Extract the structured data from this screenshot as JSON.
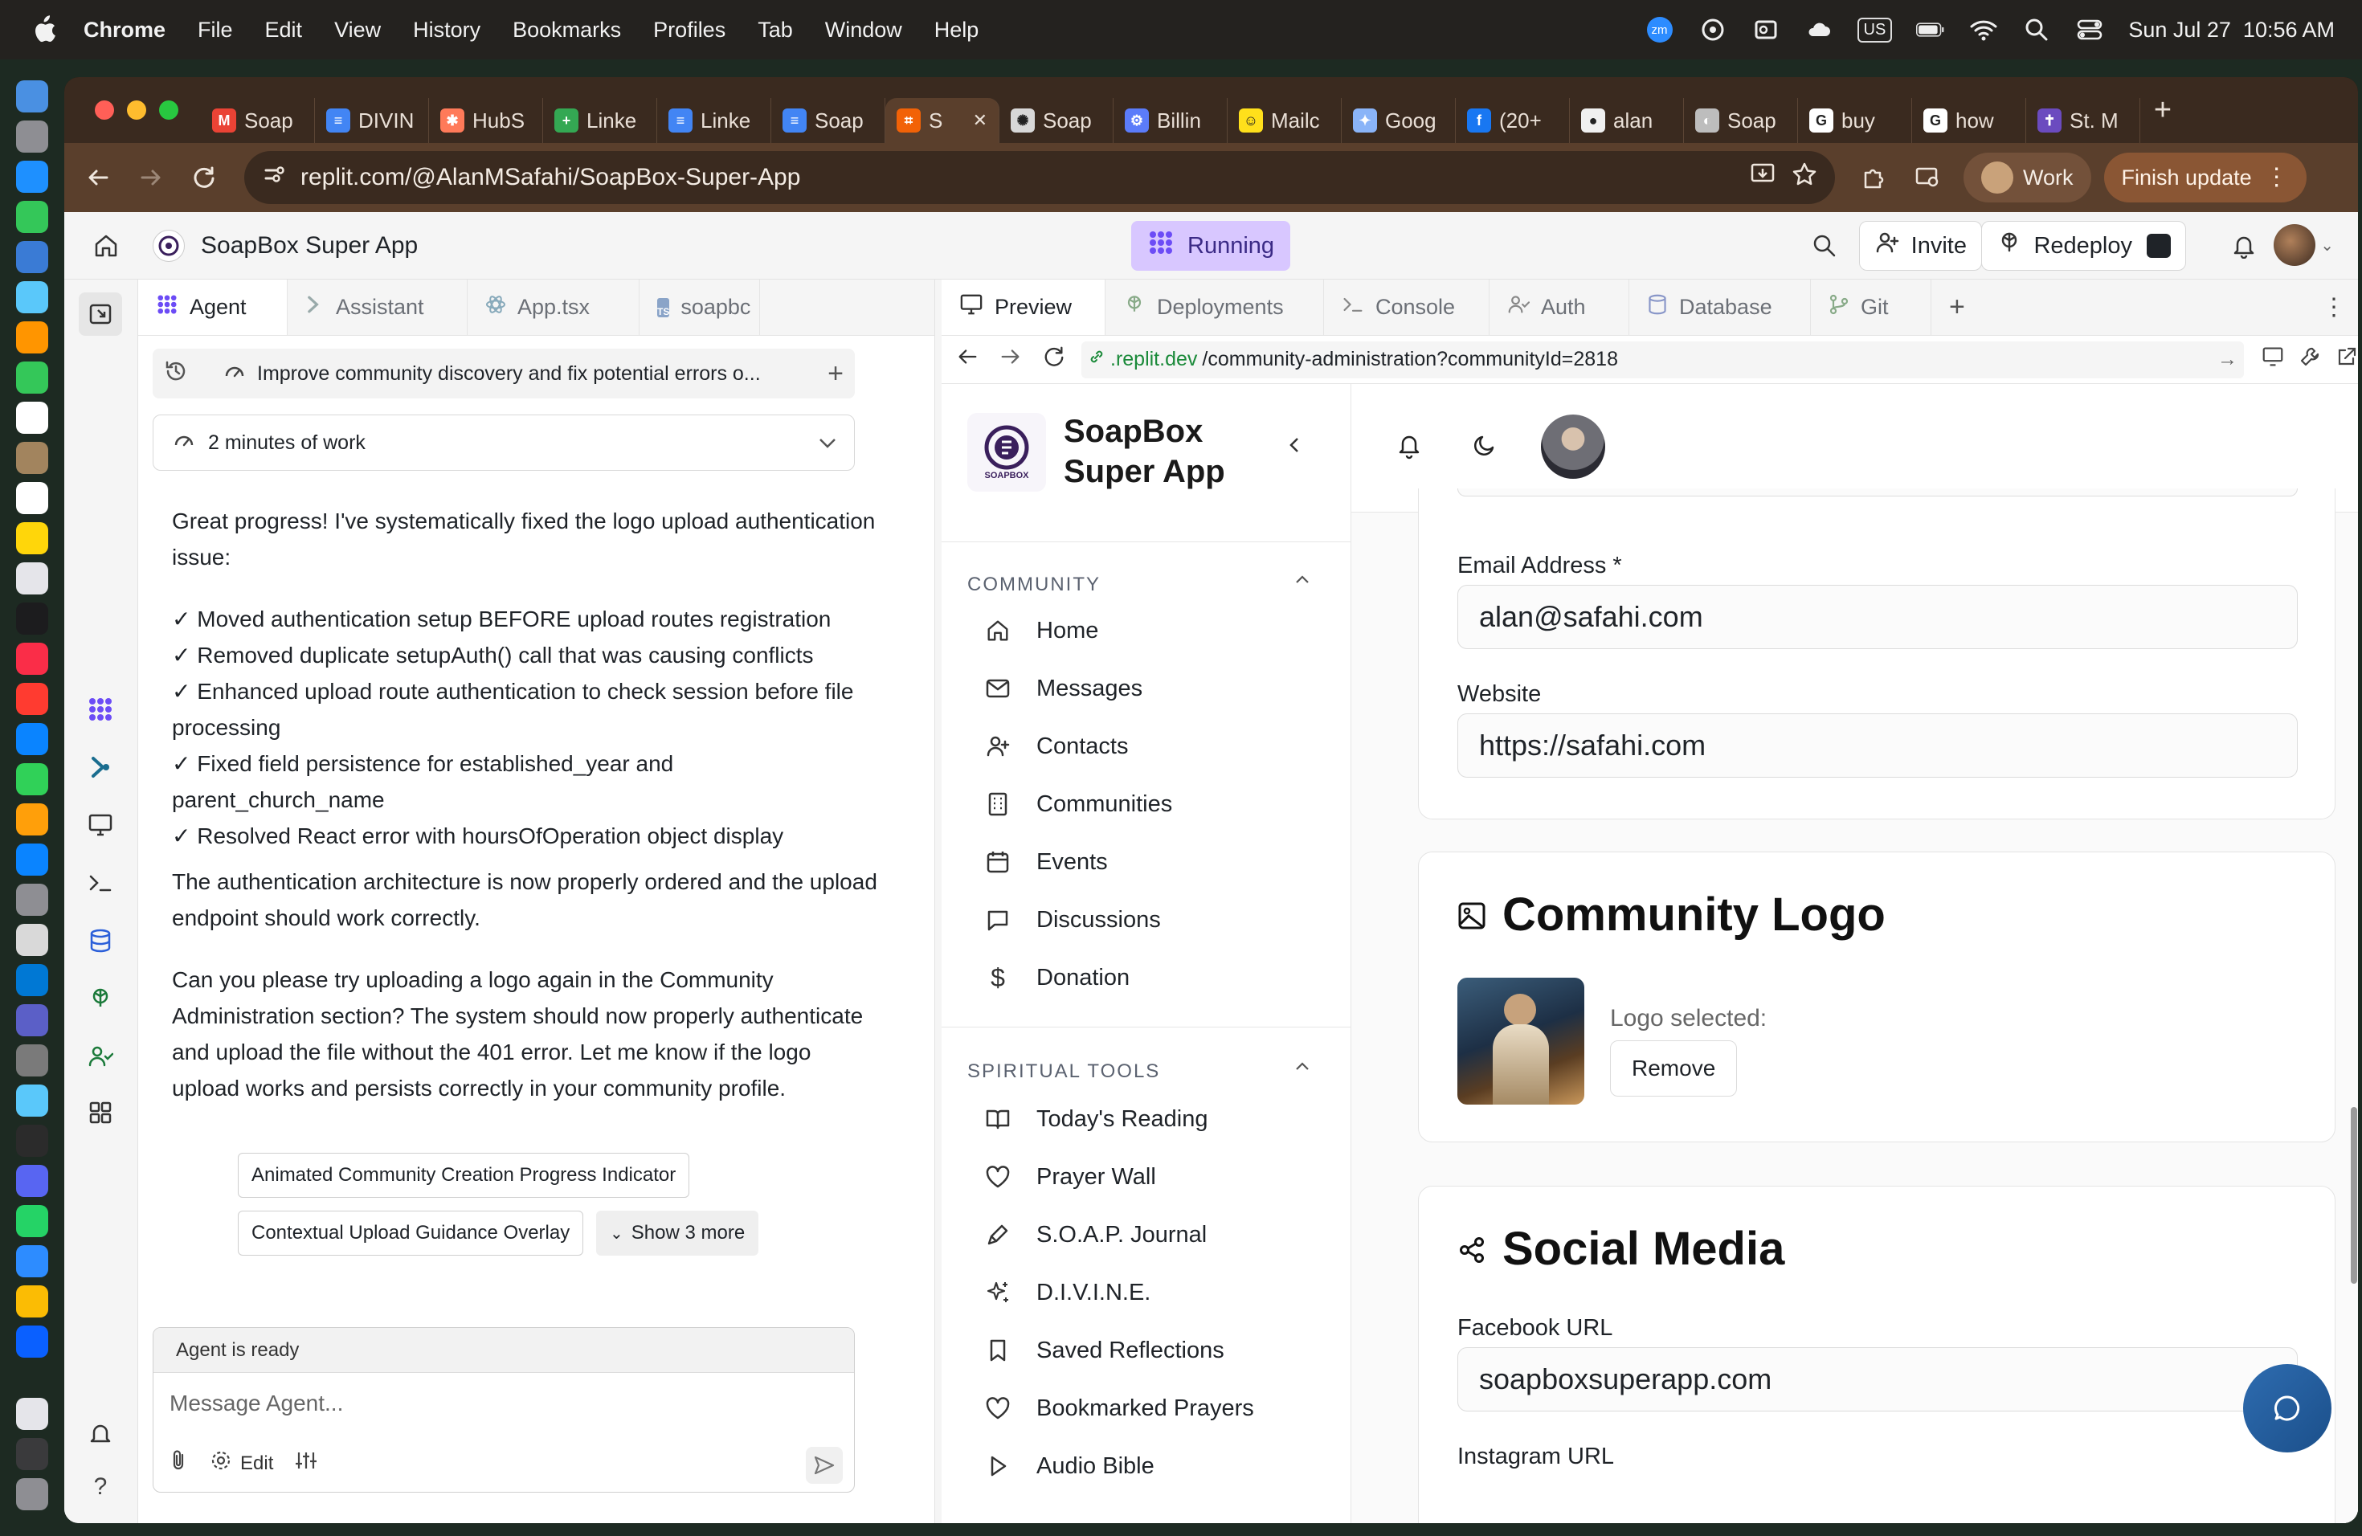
{
  "menubar": {
    "app": "Chrome",
    "items": [
      "File",
      "Edit",
      "View",
      "History",
      "Bookmarks",
      "Profiles",
      "Tab",
      "Window",
      "Help"
    ],
    "input_source": "US",
    "clock": "Sun Jul 27  10:56 AM",
    "zoom_badge": "zm"
  },
  "browser": {
    "tabs": [
      {
        "label": "Soap",
        "icon": "gmail-icon",
        "color": "#ea4335",
        "glyph": "M"
      },
      {
        "label": "DIVIN",
        "icon": "docs-icon",
        "color": "#4285f4",
        "glyph": "≡"
      },
      {
        "label": "HubS",
        "icon": "hubspot-icon",
        "color": "#ff7a59",
        "glyph": "✱"
      },
      {
        "label": "Linke",
        "icon": "sheets-icon",
        "color": "#34a853",
        "glyph": "+"
      },
      {
        "label": "Linke",
        "icon": "docs-icon",
        "color": "#4285f4",
        "glyph": "≡"
      },
      {
        "label": "Soap",
        "icon": "docs-icon",
        "color": "#4285f4",
        "glyph": "≡"
      },
      {
        "label": "S",
        "icon": "replit-icon",
        "color": "#f26207",
        "glyph": "⌗",
        "active": true
      },
      {
        "label": "Soap",
        "icon": "openai-icon",
        "color": "#d8d8d8",
        "glyph": "✺"
      },
      {
        "label": "Billin",
        "icon": "billing-icon",
        "color": "#5b7cfa",
        "glyph": "⚙"
      },
      {
        "label": "Mailc",
        "icon": "mailchimp-icon",
        "color": "#ffe01b",
        "glyph": "☺"
      },
      {
        "label": "Goog",
        "icon": "gemini-icon",
        "color": "#8ab4f8",
        "glyph": "✦"
      },
      {
        "label": "(20+",
        "icon": "facebook-icon",
        "color": "#1877f2",
        "glyph": "f"
      },
      {
        "label": "alan",
        "icon": "github-icon",
        "color": "#f0f0f0",
        "glyph": "●"
      },
      {
        "label": "Soap",
        "icon": "globe-icon",
        "color": "#bdbdbd",
        "glyph": "◐"
      },
      {
        "label": "buy",
        "icon": "google-icon",
        "color": "#ffffff",
        "glyph": "G"
      },
      {
        "label": "how",
        "icon": "google-icon",
        "color": "#ffffff",
        "glyph": "G"
      },
      {
        "label": "St. M",
        "icon": "church-icon",
        "color": "#6b4bbf",
        "glyph": "✝"
      }
    ],
    "url": "replit.com/@AlanMSafahi/SoapBox-Super-App",
    "profile": "Work",
    "update": "Finish update"
  },
  "replit": {
    "project": "SoapBox Super App",
    "status": "Running",
    "invite": "Invite",
    "redeploy": "Redeploy",
    "colors": {
      "running_bg": "#d8c7ff",
      "accent": "#6c4cf6"
    }
  },
  "agent": {
    "tabs": [
      "Agent",
      "Assistant",
      "App.tsx",
      "soapbc"
    ],
    "thread_title": "Improve community discovery and fix potential errors o...",
    "work_summary": "2 minutes of work",
    "message_intro": "Great progress! I've systematically fixed the logo upload authentication issue:",
    "bullets": [
      "✓ Moved authentication setup BEFORE upload routes registration",
      "✓ Removed duplicate setupAuth() call that was causing conflicts",
      "✓ Enhanced upload route authentication to check session before file processing",
      "✓ Fixed field persistence for established_year and parent_church_name",
      "✓ Resolved React error with hoursOfOperation object display"
    ],
    "message_p2": "The authentication architecture is now properly ordered and the upload endpoint should work correctly.",
    "message_p3": "Can you please try uploading a logo again in the Community Administration section? The system should now properly authenticate and upload the file without the 401 error. Let me know if the logo upload works and persists correctly in your community profile.",
    "suggestions": [
      "Animated Community Creation Progress Indicator",
      "Contextual Upload Guidance Overlay"
    ],
    "show_more": "Show 3 more",
    "status": "Agent is ready",
    "placeholder": "Message Agent...",
    "edit_label": "Edit"
  },
  "preview": {
    "tabs": [
      "Preview",
      "Deployments",
      "Console",
      "Auth",
      "Database",
      "Git"
    ],
    "url_host": ".replit.dev",
    "url_path": "/community-administration?communityId=2818"
  },
  "app": {
    "brand_line1": "SoapBox",
    "brand_line2": "Super App",
    "logo_text": "SOAPBOX",
    "sections": [
      {
        "label": "COMMUNITY",
        "items": [
          {
            "label": "Home",
            "icon": "home-icon"
          },
          {
            "label": "Messages",
            "icon": "mail-icon"
          },
          {
            "label": "Contacts",
            "icon": "user-plus-icon"
          },
          {
            "label": "Communities",
            "icon": "building-icon"
          },
          {
            "label": "Events",
            "icon": "calendar-icon"
          },
          {
            "label": "Discussions",
            "icon": "chat-icon"
          },
          {
            "label": "Donation",
            "icon": "dollar-icon"
          }
        ]
      },
      {
        "label": "SPIRITUAL TOOLS",
        "items": [
          {
            "label": "Today's Reading",
            "icon": "book-icon"
          },
          {
            "label": "Prayer Wall",
            "icon": "heart-icon"
          },
          {
            "label": "S.O.A.P. Journal",
            "icon": "pen-icon"
          },
          {
            "label": "D.I.V.I.N.E.",
            "icon": "sparkles-icon"
          },
          {
            "label": "Saved Reflections",
            "icon": "bookmark-icon"
          },
          {
            "label": "Bookmarked Prayers",
            "icon": "heart-icon"
          },
          {
            "label": "Audio Bible",
            "icon": "play-icon"
          }
        ]
      }
    ],
    "form": {
      "email_label": "Email Address *",
      "email_value": "alan@safahi.com",
      "website_label": "Website",
      "website_value": "https://safahi.com",
      "logo_title": "Community Logo",
      "logo_selected": "Logo selected:",
      "remove": "Remove",
      "social_title": "Social Media",
      "facebook_label": "Facebook URL",
      "facebook_value": "soapboxsuperapp.com",
      "instagram_label": "Instagram URL"
    }
  }
}
